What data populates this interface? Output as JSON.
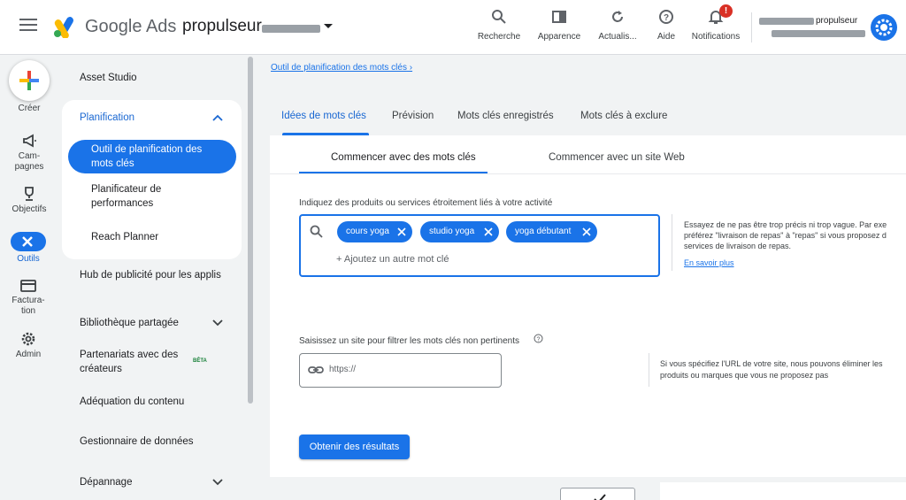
{
  "header": {
    "brand": "Google Ads",
    "account_name": "propulseur",
    "icons": [
      {
        "icon": "search-icon",
        "label": "Recherche"
      },
      {
        "icon": "appearance-icon",
        "label": "Apparence"
      },
      {
        "icon": "refresh-icon",
        "label": "Actualis..."
      },
      {
        "icon": "help-icon",
        "label": "Aide"
      },
      {
        "icon": "bell-icon",
        "label": "Notifications",
        "badge": "!"
      }
    ],
    "user_name": "propulseur"
  },
  "rail": {
    "items": [
      {
        "icon": "plus-icon",
        "label": "Créer"
      },
      {
        "icon": "megaphone-icon",
        "label": "Cam-\npagnes"
      },
      {
        "icon": "trophy-icon",
        "label": "Objectifs"
      },
      {
        "icon": "tools-icon",
        "label": "Outils",
        "active": true
      },
      {
        "icon": "billing-icon",
        "label": "Factura-\ntion"
      },
      {
        "icon": "gear-icon",
        "label": "Admin"
      }
    ]
  },
  "nav": {
    "asset_studio": "Asset Studio",
    "planning": "Planification",
    "keyword_planner": "Outil de planification des mots clés",
    "performance_planner": "Planificateur de performances",
    "reach_planner": "Reach Planner",
    "ad_hub": "Hub de publicité pour les applis",
    "shared_library": "Bibliothèque partagée",
    "creator_partnerships": "Partenariats avec des créateurs",
    "beta_badge": "BÊTA",
    "content_suitability": "Adéquation du contenu",
    "data_manager": "Gestionnaire de données",
    "troubleshooting": "Dépannage"
  },
  "main": {
    "breadcrumb": "Outil de planification des mots clés",
    "tabs": [
      "Idées de mots clés",
      "Prévision",
      "Mots clés enregistrés",
      "Mots clés à exclure"
    ],
    "subtabs": [
      "Commencer avec des mots clés",
      "Commencer avec un site Web"
    ],
    "keywords_label": "Indiquez des produits ou services étroitement liés à votre activité",
    "keywords": [
      "cours yoga",
      "studio yoga",
      "yoga débutant"
    ],
    "add_keyword_placeholder": "+ Ajoutez un autre mot clé",
    "keywords_help_line1": "Essayez de ne pas être trop précis ni trop vague. Par exe",
    "keywords_help_line2": "préférez \"livraison de repas\" à \"repas\" si vous proposez d",
    "keywords_help_line3": "services de livraison de repas.",
    "learn_more": "En savoir plus",
    "site_label": "Saisissez un site pour filtrer les mots clés non pertinents",
    "site_placeholder": "https://",
    "site_help_line1": "Si vous spécifiez l'URL de votre site, nous pouvons éliminer les",
    "site_help_line2": "produits ou marques que vous ne proposez pas",
    "get_results": "Obtenir des résultats"
  }
}
